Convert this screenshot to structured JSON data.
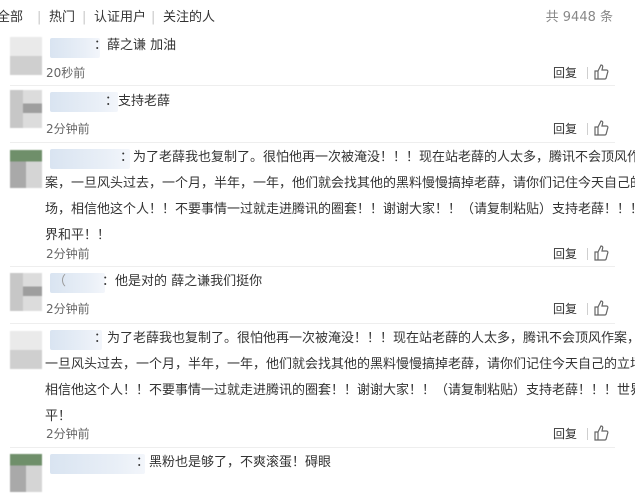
{
  "tabs": [
    "全部",
    "热门",
    "认证用户",
    "关注的人"
  ],
  "total_count": "共 9448 条",
  "reply_label": "回复",
  "comments": [
    {
      "text": "：薛之谦 加油",
      "time": "20秒前"
    },
    {
      "text": "：支持老薛",
      "time": "2分钟前"
    },
    {
      "line1": "：为了老薛我也复制了。很怕他再一次被淹没！！！现在站老薛的人太多，腾讯不会顶风作",
      "line2": "案，一旦风头过去，一个月，半年，一年，他们就会找其他的黑料慢慢搞掉老薛，请你们记住今天自己的立",
      "line3": "场，相信他这个人！！不要事情一过就走进腾讯的圈套！！谢谢大家！！（请复制粘贴）支持老薛！！！世",
      "line4": "界和平！！",
      "time": "2分钟前"
    },
    {
      "text": "：他是对的 薛之谦我们挺你",
      "prefix": "（",
      "time": "2分钟前"
    },
    {
      "line1": "：为了老薛我也复制了。很怕他再一次被淹没！！！现在站老薛的人太多，腾讯不会顶风作案，",
      "line2": "一旦风头过去，一个月，半年，一年，他们就会找其他的黑料慢慢搞掉老薛，请你们记住今天自己的立场，",
      "line3": "相信他这个人！！不要事情一过就走进腾讯的圈套！！谢谢大家！！（请复制粘贴）支持老薛！！！世界和",
      "line4": "平！",
      "time": "2分钟前"
    },
    {
      "text": "：黑粉也是够了，不爽滚蛋！碍眼"
    }
  ],
  "icons": {
    "like": "thumbs-up-icon"
  }
}
